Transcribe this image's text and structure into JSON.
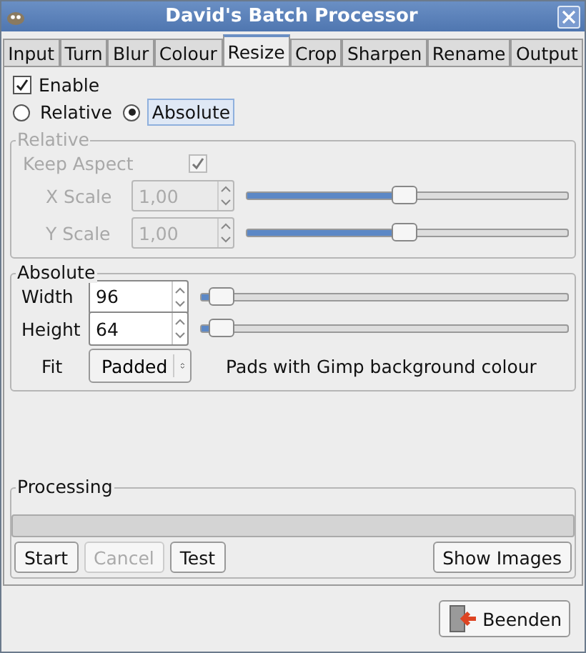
{
  "window": {
    "title": "David's Batch Processor"
  },
  "tabs": [
    {
      "label": "Input",
      "selected": false
    },
    {
      "label": "Turn",
      "selected": false
    },
    {
      "label": "Blur",
      "selected": false
    },
    {
      "label": "Colour",
      "selected": false
    },
    {
      "label": "Resize",
      "selected": true
    },
    {
      "label": "Crop",
      "selected": false
    },
    {
      "label": "Sharpen",
      "selected": false
    },
    {
      "label": "Rename",
      "selected": false
    },
    {
      "label": "Output",
      "selected": false
    }
  ],
  "enable": {
    "label": "Enable",
    "checked": true
  },
  "modes": [
    {
      "label": "Relative",
      "selected": false
    },
    {
      "label": "Absolute",
      "selected": true
    }
  ],
  "relative": {
    "title": "Relative",
    "disabled": true,
    "keep_aspect": {
      "label": "Keep Aspect",
      "checked": true
    },
    "scales": [
      {
        "label": "X Scale",
        "value": "1,00",
        "level": 0.49
      },
      {
        "label": "Y Scale",
        "value": "1,00",
        "level": 0.49
      }
    ]
  },
  "absolute": {
    "title": "Absolute",
    "sizes": [
      {
        "label": "Width",
        "value": "96",
        "level": 0.02
      },
      {
        "label": "Height",
        "value": "64",
        "level": 0.02
      }
    ],
    "fit": {
      "label": "Fit",
      "value": "Padded",
      "note": "Pads with Gimp background colour"
    }
  },
  "processing": {
    "title": "Processing",
    "level": 0,
    "buttons": [
      {
        "label": "Start",
        "disabled": false
      },
      {
        "label": "Cancel",
        "disabled": true
      },
      {
        "label": "Test",
        "disabled": false
      },
      {
        "label": "Show Images",
        "disabled": false
      }
    ]
  },
  "quit_button": {
    "label": "Beenden"
  }
}
